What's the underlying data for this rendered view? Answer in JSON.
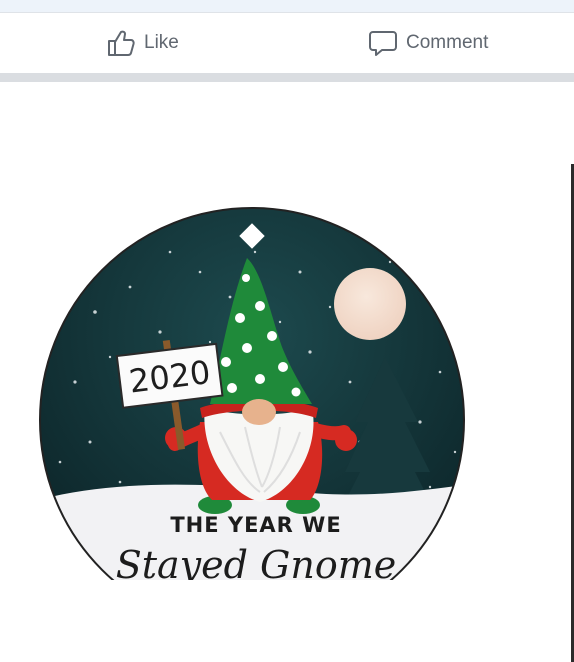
{
  "actions": {
    "like_label": "Like",
    "comment_label": "Comment"
  },
  "ornament": {
    "sign_text": "2020",
    "line1": "THE YEAR WE",
    "line2": "Stayed Gnome"
  },
  "colors": {
    "sky": "#0f2e33",
    "hat_green": "#1f8a3a",
    "coat_red": "#d62a22",
    "moon": "#f3ddd0",
    "action_text": "#606770"
  },
  "icons": {
    "like": "thumbs-up-icon",
    "comment": "speech-bubble-icon"
  }
}
